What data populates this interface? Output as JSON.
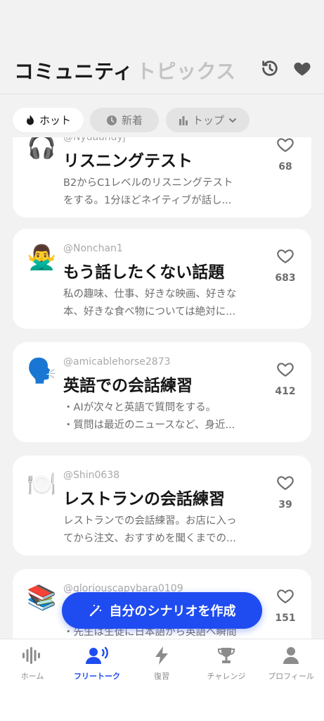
{
  "header": {
    "tabs": [
      "コミュニティ",
      "トピックス"
    ],
    "icons": [
      "history-icon",
      "heart-icon"
    ]
  },
  "filters": [
    {
      "label": "ホット",
      "icon": "flame-icon",
      "active": true
    },
    {
      "label": "新着",
      "icon": "clock-icon",
      "active": false
    },
    {
      "label": "トップ",
      "icon": "bar-chart-icon",
      "active": false
    }
  ],
  "posts": [
    {
      "author": "@Nyuaandyj",
      "emoji": "🎧",
      "title": "リスニングテスト",
      "desc_lines": [
        "B2からC1レベルのリスニングテスト",
        "をする。1分ほどネイティブが話し..."
      ],
      "likes": "68"
    },
    {
      "author": "@Nonchan1",
      "emoji": "🙅‍♂️",
      "title": "もう話したくない話題",
      "desc_lines": [
        "私の趣味、仕事、好きな映画、好きな",
        "本、好きな食べ物については絶対に..."
      ],
      "likes": "683"
    },
    {
      "author": "@amicablehorse2873",
      "emoji": "🗣️",
      "title": "英語での会話練習",
      "desc_lines": [
        "・AIが次々と英語で質問をする。",
        "・質問は最近のニュースなど、身近..."
      ],
      "likes": "412"
    },
    {
      "author": "@Shin0638",
      "emoji": "🍽️",
      "title": "レストランの会話練習",
      "desc_lines": [
        "レストランでの会話練習。お店に入っ",
        "てから注文、おすすめを聞くまでの..."
      ],
      "likes": "39"
    },
    {
      "author": "@gloriouscapybara0109",
      "emoji": "📚",
      "title": "",
      "desc_lines": [
        "・先生は生徒に日本語から英語へ瞬間"
      ],
      "likes": "151"
    }
  ],
  "fab": {
    "label": "自分のシナリオを作成",
    "icon": "magic-wand-icon"
  },
  "nav": [
    {
      "label": "ホーム",
      "icon": "waveform-icon",
      "active": false
    },
    {
      "label": "フリートーク",
      "icon": "speaking-person-icon",
      "active": true
    },
    {
      "label": "復習",
      "icon": "lightning-icon",
      "active": false
    },
    {
      "label": "チャレンジ",
      "icon": "trophy-icon",
      "active": false
    },
    {
      "label": "プロフィール",
      "icon": "person-icon",
      "active": false
    }
  ],
  "colors": {
    "accent": "#1f4cf0",
    "background": "#f2f2f2",
    "card": "#ffffff",
    "muted": "#6d6d6d"
  }
}
